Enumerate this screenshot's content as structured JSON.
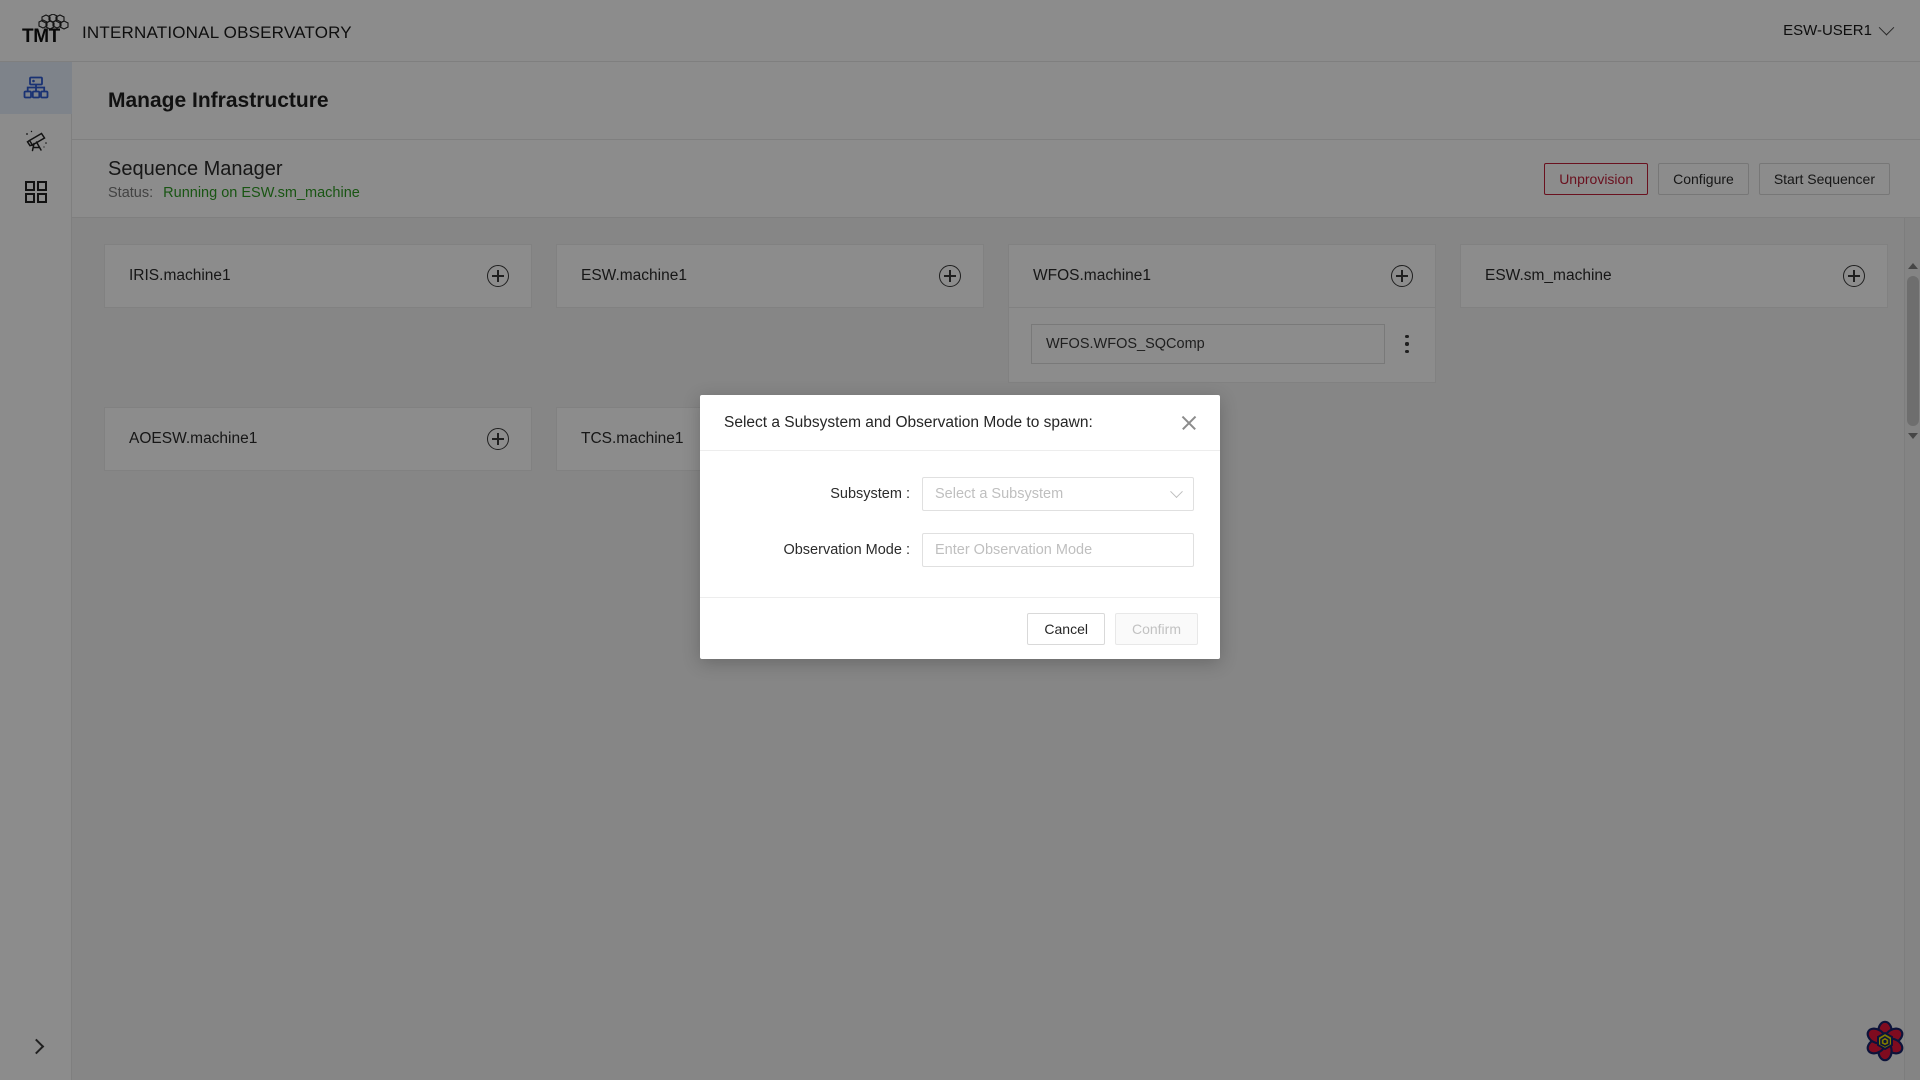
{
  "header": {
    "brand_tmt": "TMT",
    "brand_name": "INTERNATIONAL OBSERVATORY",
    "logo_icon": "hex-mirror-segments-logo",
    "user_label": "ESW-USER1",
    "user_chevron_icon": "chevron-down-icon"
  },
  "sidebar": {
    "items": [
      {
        "icon": "sitemap-icon",
        "name": "manage-infrastructure",
        "active": true
      },
      {
        "icon": "telescope-icon",
        "name": "observe",
        "active": false
      },
      {
        "icon": "grid-icon",
        "name": "resources",
        "active": false
      }
    ],
    "expand_icon": "chevron-right-icon"
  },
  "page": {
    "title": "Manage Infrastructure"
  },
  "sequence_manager": {
    "name": "Sequence Manager",
    "status_label": "Status:",
    "status_value": "Running on ESW.sm_machine",
    "status_color": "#2e9b24",
    "buttons": [
      {
        "label": "Unprovision",
        "style": "danger"
      },
      {
        "label": "Configure",
        "style": "default"
      },
      {
        "label": "Start Sequencer",
        "style": "default"
      }
    ]
  },
  "machines": [
    {
      "title": "IRIS.machine1",
      "add_icon": "plus-circle-icon",
      "sequencers": []
    },
    {
      "title": "ESW.machine1",
      "add_icon": "plus-circle-icon",
      "sequencers": []
    },
    {
      "title": "WFOS.machine1",
      "add_icon": "plus-circle-icon",
      "sequencers": [
        {
          "label": "WFOS.WFOS_SQComp",
          "menu_icon": "kebab-menu-icon"
        }
      ]
    },
    {
      "title": "ESW.sm_machine",
      "add_icon": "plus-circle-icon",
      "sequencers": []
    },
    {
      "title": "AOESW.machine1",
      "add_icon": "plus-circle-icon",
      "sequencers": []
    },
    {
      "title": "TCS.machine1",
      "add_icon": "plus-circle-icon",
      "sequencers": []
    }
  ],
  "scrollbar": {
    "up_icon": "scroll-up-arrow-icon",
    "down_icon": "scroll-down-arrow-icon"
  },
  "badge": {
    "icon": "flower-logo-icon",
    "petal_color": "#e8153a",
    "center_color": "#e8e000",
    "outline_color": "#1b2a6b"
  },
  "modal": {
    "title": "Select a Subsystem and Observation Mode to spawn:",
    "close_icon": "close-icon",
    "fields": [
      {
        "label": "Subsystem :",
        "placeholder": "Select a Subsystem",
        "value": "",
        "type": "select",
        "chevron_icon": "chevron-down-icon"
      },
      {
        "label": "Observation Mode :",
        "placeholder": "Enter Observation Mode",
        "value": "",
        "type": "text"
      }
    ],
    "cancel_label": "Cancel",
    "confirm_label": "Confirm",
    "confirm_disabled": true
  }
}
